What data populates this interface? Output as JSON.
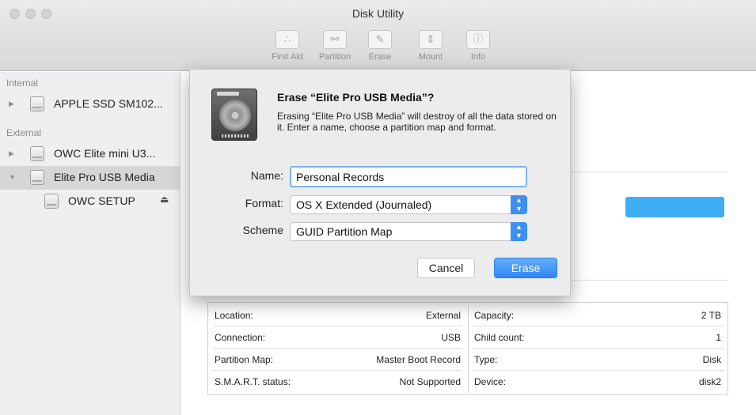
{
  "window": {
    "title": "Disk Utility"
  },
  "toolbar": {
    "items": [
      {
        "label": "First Aid",
        "icon": "stethoscope-icon"
      },
      {
        "label": "Partition",
        "icon": "partition-icon"
      },
      {
        "label": "Erase",
        "icon": "erase-icon"
      },
      {
        "label": "Mount",
        "icon": "mount-icon"
      },
      {
        "label": "Info",
        "icon": "info-icon"
      }
    ]
  },
  "sidebar": {
    "internal_label": "Internal",
    "external_label": "External",
    "items": [
      {
        "label": "APPLE SSD SM102..."
      },
      {
        "label": "OWC Elite mini U3..."
      },
      {
        "label": "Elite Pro USB Media"
      },
      {
        "label": "OWC SETUP"
      }
    ]
  },
  "dialog": {
    "title": "Erase “Elite Pro USB Media”?",
    "message": "Erasing “Elite Pro USB Media” will destroy of all the data stored on it. Enter a name, choose a partition map and format.",
    "name_label": "Name:",
    "name_value": "Personal Records",
    "format_label": "Format:",
    "format_value": "OS X Extended (Journaled)",
    "scheme_label": "Scheme",
    "scheme_value": "GUID Partition Map",
    "cancel_label": "Cancel",
    "erase_label": "Erase"
  },
  "info": {
    "rows": [
      {
        "k1": "Location:",
        "v1": "External",
        "k2": "Capacity:",
        "v2": "2 TB"
      },
      {
        "k1": "Connection:",
        "v1": "USB",
        "k2": "Child count:",
        "v2": "1"
      },
      {
        "k1": "Partition Map:",
        "v1": "Master Boot Record",
        "k2": "Type:",
        "v2": "Disk"
      },
      {
        "k1": "S.M.A.R.T. status:",
        "v1": "Not Supported",
        "k2": "Device:",
        "v2": "disk2"
      }
    ]
  },
  "colors": {
    "accent": "#3c8ff5",
    "capacity_bar": "#3eaef5"
  }
}
